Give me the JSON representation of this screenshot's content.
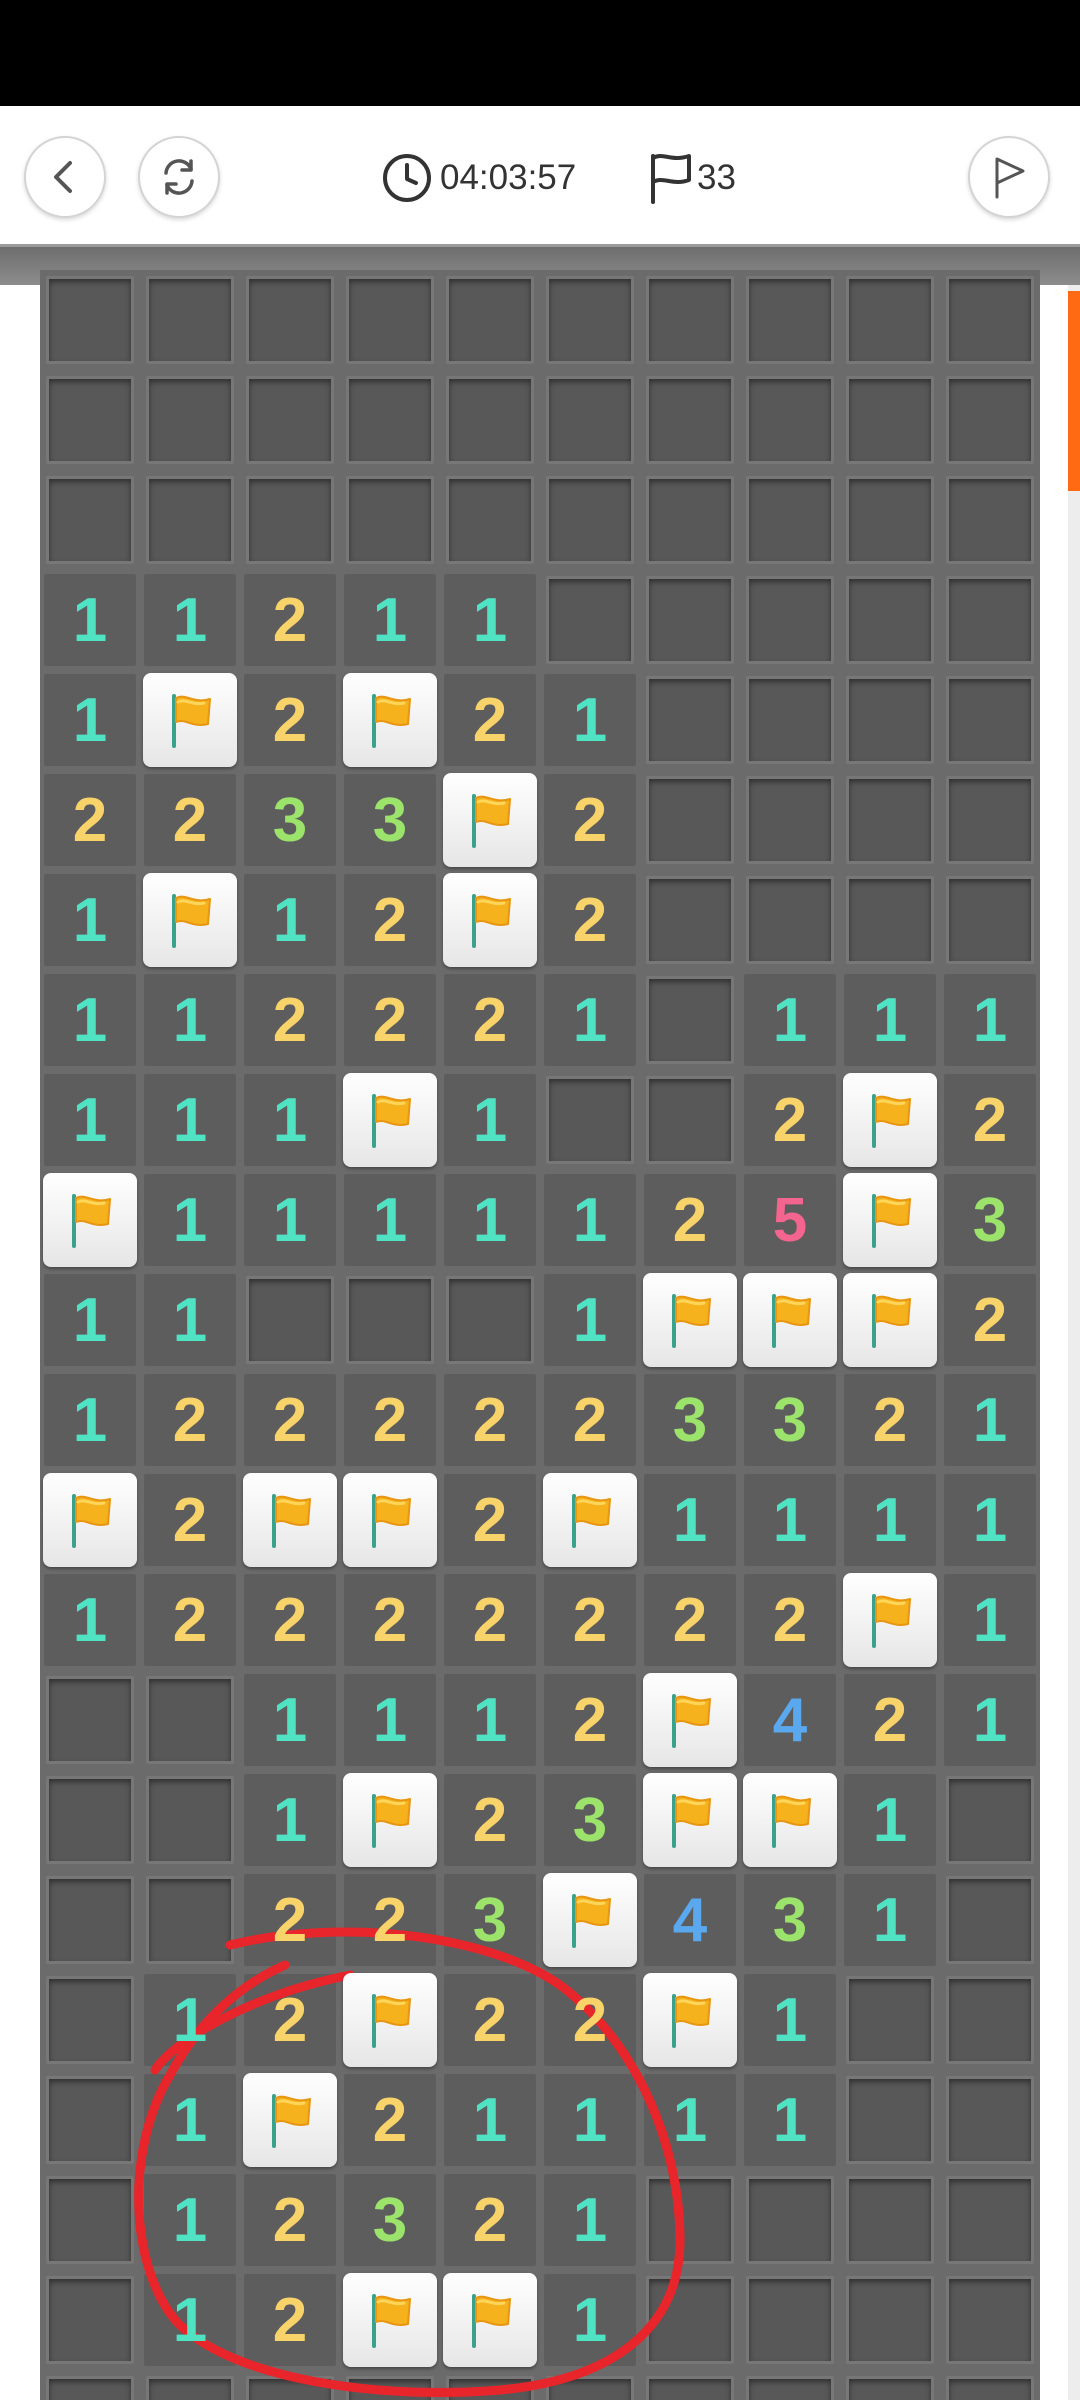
{
  "header": {
    "back_icon": "chevron-left-icon",
    "restart_icon": "refresh-icon",
    "timer_icon": "clock-icon",
    "timer": "04:03:57",
    "flag_icon": "flag-outline-icon",
    "flags_remaining": "33",
    "flag_mode_icon": "flag-mode-icon"
  },
  "colors": {
    "n1": "#4fe3c4",
    "n2": "#f7d36a",
    "n3": "#9be36b",
    "n4": "#5aa8ee",
    "n5": "#f3648f",
    "accent": "#ff6a13",
    "annotation": "#e8252a"
  },
  "board": {
    "columns": 10,
    "legend": "H = unrevealed tile, F = flagged tile, digit = revealed number",
    "rows": [
      [
        "H",
        "H",
        "H",
        "H",
        "H",
        "H",
        "H",
        "H",
        "H",
        "H"
      ],
      [
        "H",
        "H",
        "H",
        "H",
        "H",
        "H",
        "H",
        "H",
        "H",
        "H"
      ],
      [
        "H",
        "H",
        "H",
        "H",
        "H",
        "H",
        "H",
        "H",
        "H",
        "H"
      ],
      [
        "1",
        "1",
        "2",
        "1",
        "1",
        "H",
        "H",
        "H",
        "H",
        "H"
      ],
      [
        "1",
        "F",
        "2",
        "F",
        "2",
        "1",
        "H",
        "H",
        "H",
        "H"
      ],
      [
        "2",
        "2",
        "3",
        "3",
        "F",
        "2",
        "H",
        "H",
        "H",
        "H"
      ],
      [
        "1",
        "F",
        "1",
        "2",
        "F",
        "2",
        "H",
        "H",
        "H",
        "H"
      ],
      [
        "1",
        "1",
        "2",
        "2",
        "2",
        "1",
        "H",
        "1",
        "1",
        "1"
      ],
      [
        "1",
        "1",
        "1",
        "F",
        "1",
        "H",
        "H",
        "2",
        "F",
        "2"
      ],
      [
        "F",
        "1",
        "1",
        "1",
        "1",
        "1",
        "2",
        "5",
        "F",
        "3"
      ],
      [
        "1",
        "1",
        "H",
        "H",
        "H",
        "1",
        "F",
        "F",
        "F",
        "2"
      ],
      [
        "1",
        "2",
        "2",
        "2",
        "2",
        "2",
        "3",
        "3",
        "2",
        "1"
      ],
      [
        "F",
        "2",
        "F",
        "F",
        "2",
        "F",
        "1",
        "1",
        "1",
        "1"
      ],
      [
        "1",
        "2",
        "2",
        "2",
        "2",
        "2",
        "2",
        "2",
        "F",
        "1"
      ],
      [
        "H",
        "H",
        "1",
        "1",
        "1",
        "2",
        "F",
        "4",
        "2",
        "1"
      ],
      [
        "H",
        "H",
        "1",
        "F",
        "2",
        "3",
        "F",
        "F",
        "1",
        "H"
      ],
      [
        "H",
        "H",
        "2",
        "2",
        "3",
        "F",
        "4",
        "3",
        "1",
        "H"
      ],
      [
        "H",
        "1",
        "2",
        "F",
        "2",
        "2",
        "F",
        "1",
        "H",
        "H"
      ],
      [
        "H",
        "1",
        "F",
        "2",
        "1",
        "1",
        "1",
        "1",
        "H",
        "H"
      ],
      [
        "H",
        "1",
        "2",
        "3",
        "2",
        "1",
        "H",
        "H",
        "H",
        "H"
      ],
      [
        "H",
        "1",
        "2",
        "F",
        "F",
        "1",
        "H",
        "H",
        "H",
        "H"
      ],
      [
        "H",
        "H",
        "H",
        "H",
        "H",
        "H",
        "H",
        "H",
        "H",
        "H"
      ]
    ]
  }
}
